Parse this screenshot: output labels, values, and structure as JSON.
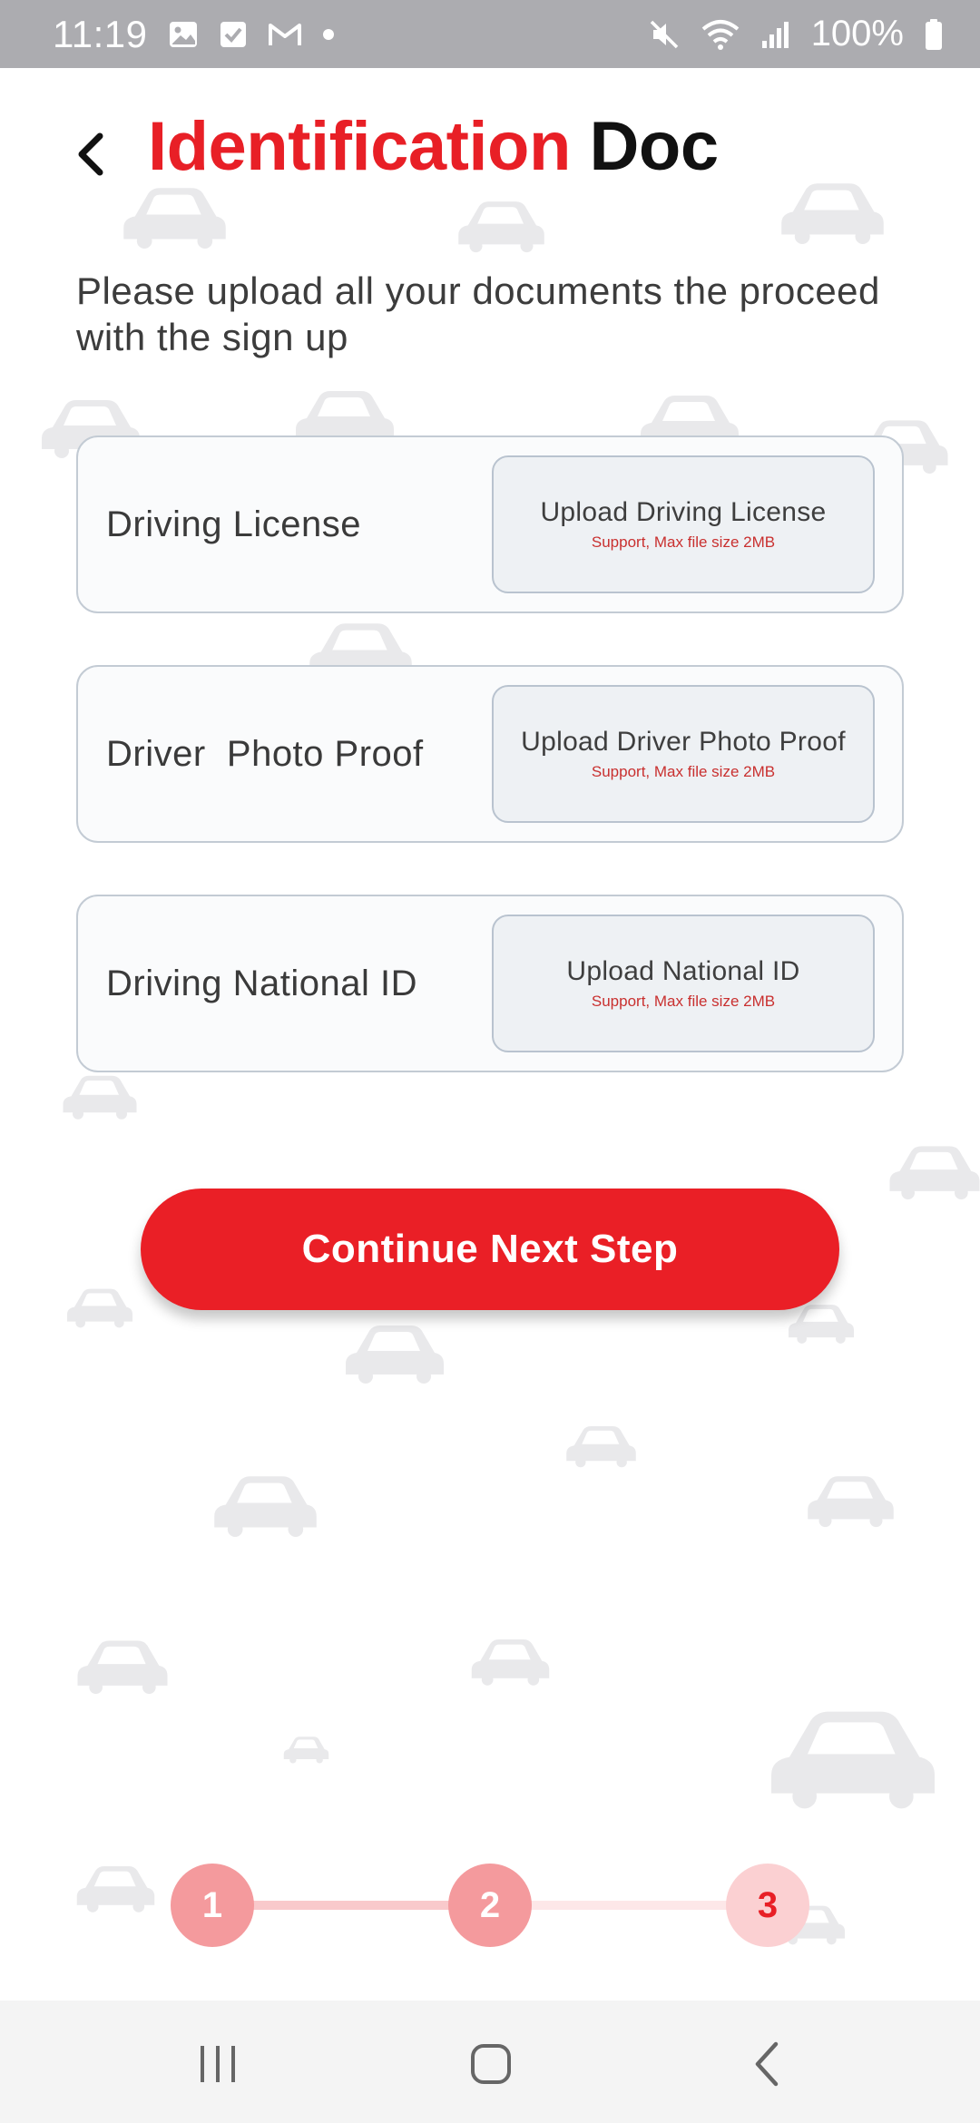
{
  "status_bar": {
    "time": "11:19",
    "battery": "100%",
    "left_icons": [
      "gallery-icon",
      "checkbox-icon",
      "gmail-icon",
      "dot-icon"
    ],
    "right_icons": [
      "mute-icon",
      "wifi-icon",
      "signal-icon",
      "battery-icon"
    ]
  },
  "header": {
    "title_part1": "Identification",
    "title_part2": " Doc",
    "back_icon": "chevron-left-icon"
  },
  "subtitle": "Please upload all your documents the proceed with the sign up",
  "documents": [
    {
      "label": "Driving License",
      "upload_title": "Upload Driving License",
      "upload_hint": "Support, Max file size 2MB"
    },
    {
      "label": "Driver  Photo Proof",
      "upload_title": "Upload Driver Photo Proof",
      "upload_hint": "Support, Max file size 2MB"
    },
    {
      "label": "Driving National ID",
      "upload_title": "Upload National ID",
      "upload_hint": "Support, Max file size 2MB"
    }
  ],
  "continue_button": "Continue Next Step",
  "stepper": {
    "steps": [
      "1",
      "2",
      "3"
    ],
    "current_step": 3
  },
  "colors": {
    "accent": "#e81f26",
    "step_done": "#f49a9d",
    "step_current_bg": "#fbd0d2"
  },
  "nav_bar": {
    "icons": [
      "recent-apps-icon",
      "home-icon",
      "back-icon"
    ]
  }
}
